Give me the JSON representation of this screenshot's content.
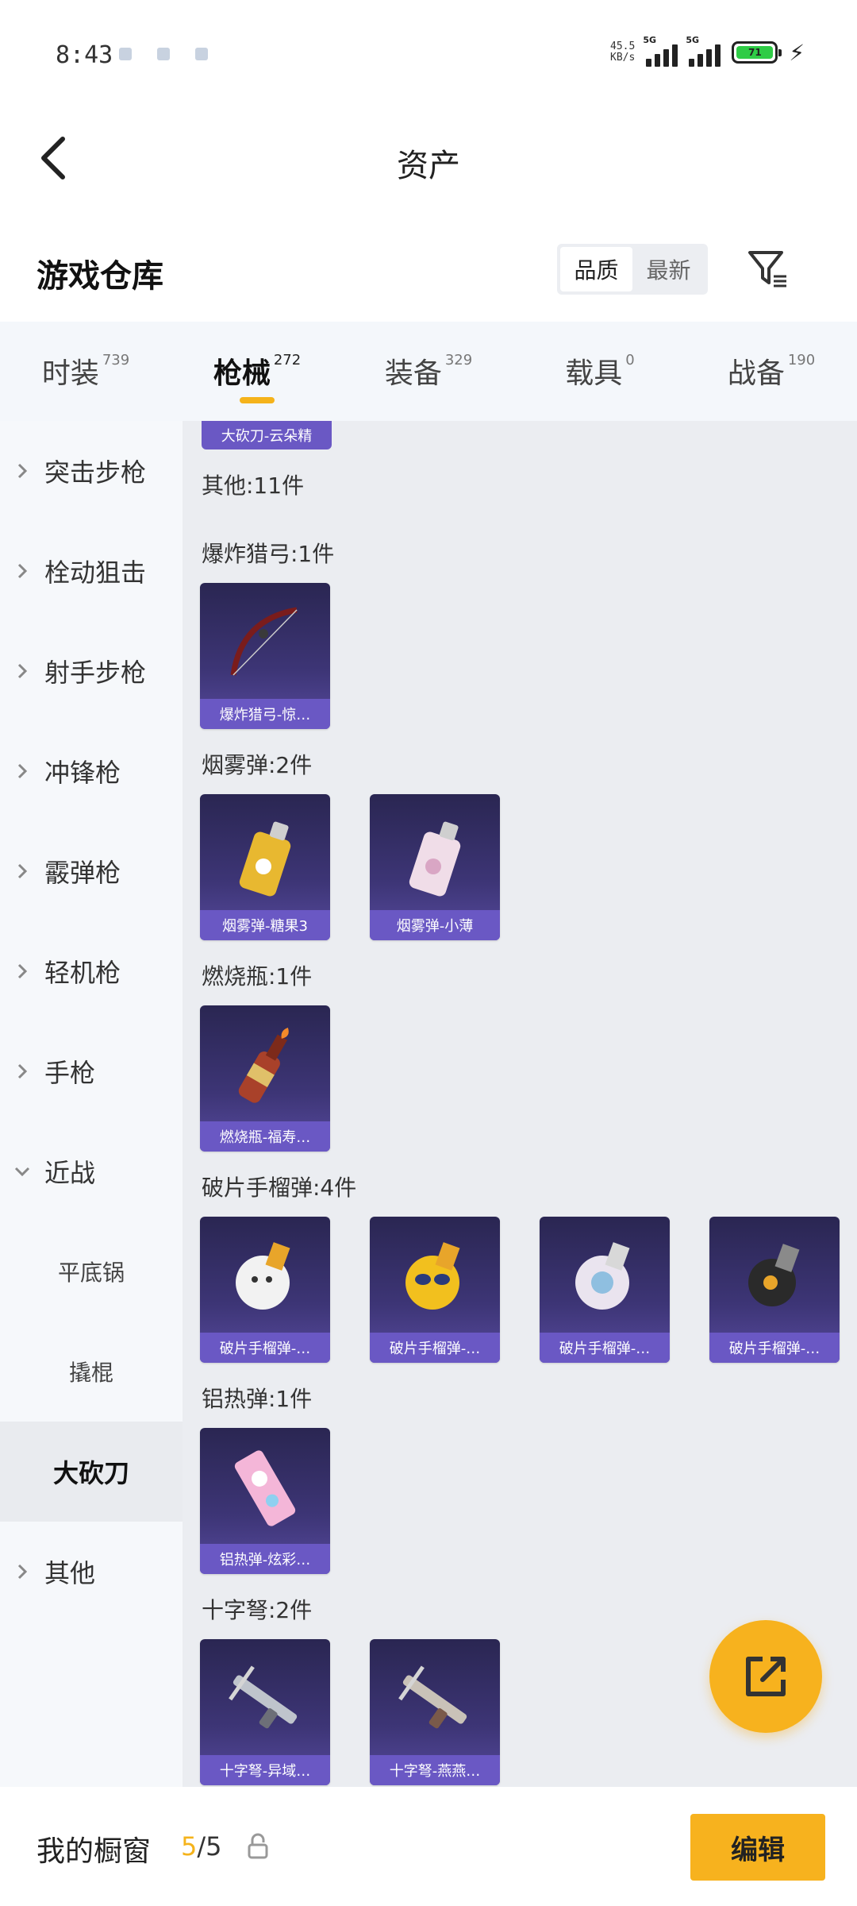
{
  "status": {
    "time": "8:43",
    "net_speed_value": "45.5",
    "net_speed_unit": "KB/s",
    "network": "5G",
    "battery": "71"
  },
  "nav": {
    "title": "资产"
  },
  "warehouse": {
    "title": "游戏仓库",
    "sort_options": [
      "品质",
      "最新"
    ],
    "active_sort": "品质"
  },
  "tabs": [
    {
      "label": "时装",
      "count": "739"
    },
    {
      "label": "枪械",
      "count": "272"
    },
    {
      "label": "装备",
      "count": "329"
    },
    {
      "label": "载具",
      "count": "0"
    },
    {
      "label": "战备",
      "count": "190"
    }
  ],
  "sidebar": {
    "items": [
      {
        "label": "突击步枪"
      },
      {
        "label": "栓动狙击"
      },
      {
        "label": "射手步枪"
      },
      {
        "label": "冲锋枪"
      },
      {
        "label": "霰弹枪"
      },
      {
        "label": "轻机枪"
      },
      {
        "label": "手枪"
      },
      {
        "label": "近战"
      },
      {
        "label": "平底锅"
      },
      {
        "label": "撬棍"
      },
      {
        "label": "大砍刀"
      },
      {
        "label": "其他"
      }
    ]
  },
  "content": {
    "top_card": "大砍刀-云朵精",
    "other_label": "其他:11件",
    "groups": [
      {
        "label": "爆炸猎弓:1件",
        "items": [
          "爆炸猎弓-惊…"
        ]
      },
      {
        "label": "烟雾弹:2件",
        "items": [
          "烟雾弹-糖果3",
          "烟雾弹-小薄"
        ]
      },
      {
        "label": "燃烧瓶:1件",
        "items": [
          "燃烧瓶-福寿…"
        ]
      },
      {
        "label": "破片手榴弹:4件",
        "items": [
          "破片手榴弹-…",
          "破片手榴弹-…",
          "破片手榴弹-…",
          "破片手榴弹-…"
        ]
      },
      {
        "label": "铝热弹:1件",
        "items": [
          "铝热弹-炫彩…"
        ]
      },
      {
        "label": "十字弩:2件",
        "items": [
          "十字弩-异域…",
          "十字弩-燕燕…"
        ]
      }
    ]
  },
  "bottom": {
    "label": "我的橱窗",
    "current": "5",
    "total": "/5",
    "edit_label": "编辑"
  },
  "colors": {
    "accent": "#f7b21e",
    "card_label": "#6a58c4"
  }
}
